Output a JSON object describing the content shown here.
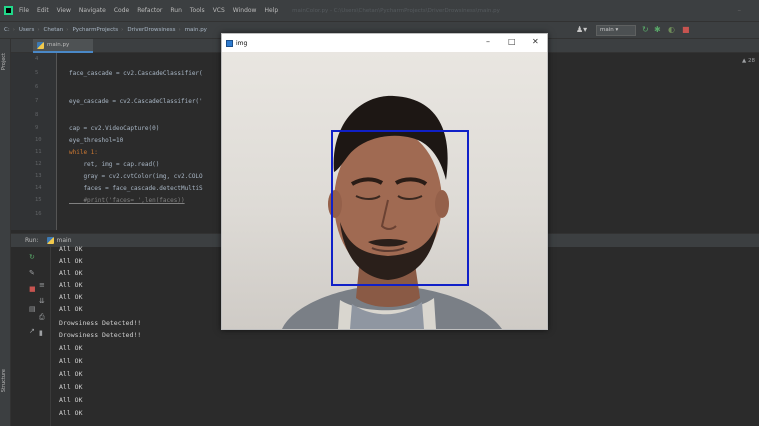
{
  "menubar": {
    "items": [
      "File",
      "Edit",
      "View",
      "Navigate",
      "Code",
      "Refactor",
      "Run",
      "Tools",
      "VCS",
      "Window",
      "Help"
    ],
    "window_title": "mainColor.py - C:\\Users\\Chetan\\PycharmProjects\\DriverDrowsiness\\main.py"
  },
  "navbar": {
    "crumbs": [
      "C:",
      "Users",
      "Chetan",
      "PycharmProjects",
      "DriverDrowsiness",
      "main.py"
    ],
    "run_config": "main"
  },
  "sidebar": {
    "project_label": "Project",
    "structure_label": "Structure"
  },
  "editor_tab": {
    "label": "main.py"
  },
  "editor": {
    "warning_count": "▲ 28",
    "lines": [
      {
        "num": "4",
        "code": ""
      },
      {
        "num": "5",
        "code": "face_cascade = cv2.CascadeClassifier("
      },
      {
        "num": "6",
        "code": ""
      },
      {
        "num": "7",
        "code": "eye_cascade = cv2.CascadeClassifier('"
      },
      {
        "num": "8",
        "code": ""
      },
      {
        "num": "9",
        "code": "cap = cv2.VideoCapture(0)"
      },
      {
        "num": "10",
        "code": "eye_threshol=10"
      },
      {
        "num": "11",
        "code": "while 1:"
      },
      {
        "num": "12",
        "code": "    ret, img = cap.read()"
      },
      {
        "num": "13",
        "code": "    gray = cv2.cvtColor(img, cv2.COLO"
      },
      {
        "num": "14",
        "code": "    faces = face_cascade.detectMultiS"
      },
      {
        "num": "15",
        "code": "    #print('faces= ',len(faces))"
      },
      {
        "num": "16",
        "code": ""
      }
    ]
  },
  "run": {
    "label": "Run:",
    "tab": "main",
    "console_lines": [
      "All OK",
      "All OK",
      "All OK",
      "All OK",
      "All OK",
      "All OK",
      "Drowsiness Detected!!",
      "Drowsiness Detected!!",
      "All OK",
      "All OK",
      "All OK",
      "All OK",
      "All OK",
      "All OK"
    ]
  },
  "img_window": {
    "title": "img",
    "minimize": "–",
    "maximize": "□",
    "close": "✕"
  },
  "colors": {
    "face_box": "#1020c8",
    "ide_bg": "#2b2b2b"
  }
}
